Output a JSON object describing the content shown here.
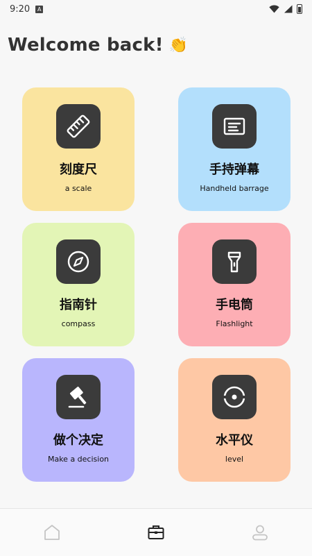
{
  "status_bar": {
    "time": "9:20",
    "notification_glyph": "A"
  },
  "header": {
    "title": "Welcome back!",
    "emoji": "👏"
  },
  "tools": [
    {
      "title": "刻度尺",
      "subtitle": "a scale",
      "icon": "ruler-icon",
      "color": "#fae49f"
    },
    {
      "title": "手持弹幕",
      "subtitle": "Handheld barrage",
      "icon": "barrage-icon",
      "color": "#b3dffc"
    },
    {
      "title": "指南针",
      "subtitle": "compass",
      "icon": "compass-icon",
      "color": "#e3f5b6"
    },
    {
      "title": "手电筒",
      "subtitle": "Flashlight",
      "icon": "flashlight-icon",
      "color": "#fdaeb4"
    },
    {
      "title": "做个决定",
      "subtitle": "Make a decision",
      "icon": "gavel-icon",
      "color": "#b9b6fd"
    },
    {
      "title": "水平仪",
      "subtitle": "level",
      "icon": "level-icon",
      "color": "#fec8a5"
    }
  ],
  "bottom_nav": [
    {
      "name": "home",
      "icon": "home-icon",
      "active": false
    },
    {
      "name": "toolbox",
      "icon": "toolbox-icon",
      "active": true
    },
    {
      "name": "profile",
      "icon": "user-icon",
      "active": false
    }
  ]
}
